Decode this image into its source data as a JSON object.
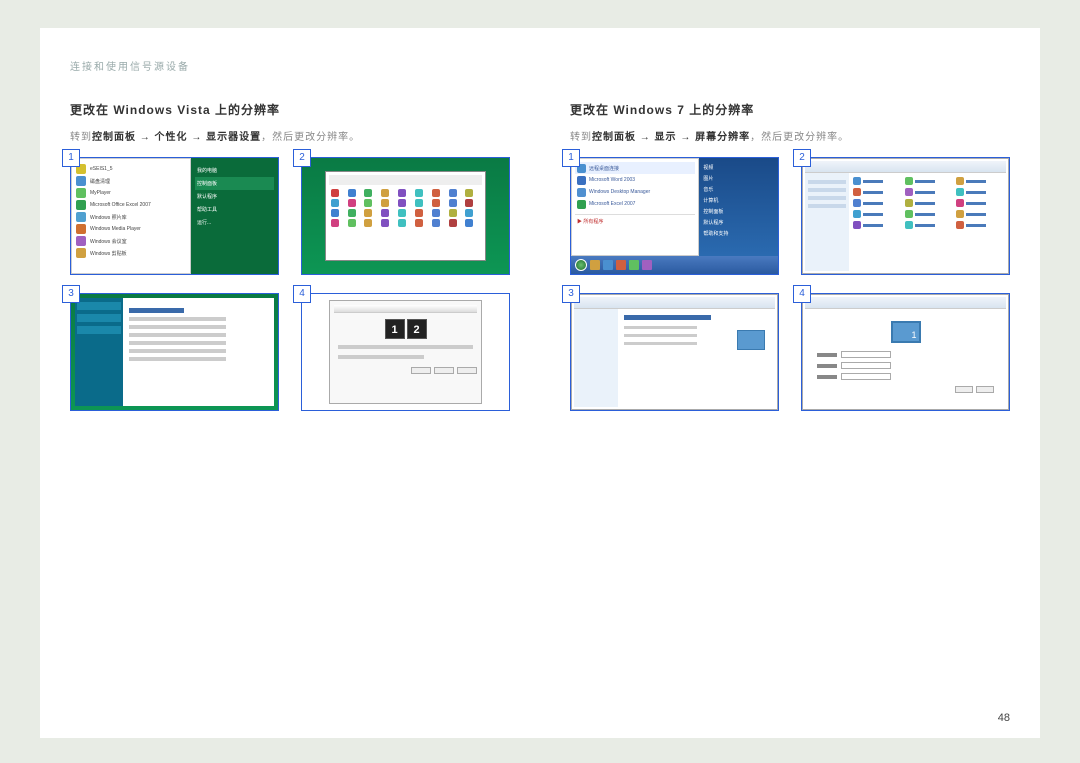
{
  "header": "连接和使用信号源设备",
  "page_number": "48",
  "vista": {
    "title": "更改在 Windows Vista 上的分辨率",
    "path_prefix": "转到",
    "path_bold": "控制面板 → 个性化 → 显示器设置",
    "path_suffix": "，然后更改分辨率。",
    "steps": [
      "1",
      "2",
      "3",
      "4"
    ],
    "step4_monitors": [
      "1",
      "2"
    ],
    "start_menu_left": [
      "eSEIS1_5",
      "磁盘清理",
      "MyPlayer",
      "Microsoft Office Excel 2007",
      "Windows 照片库",
      "Windows Media Player",
      "Windows 会议室",
      "Windows 剪贴板"
    ],
    "start_menu_right": [
      "我的电脑",
      "控制面板",
      "默认程序",
      "帮助工具",
      "运行..."
    ]
  },
  "win7": {
    "title": "更改在 Windows 7 上的分辨率",
    "path_prefix": "转到",
    "path_bold": "控制面板 → 显示 → 屏幕分辨率",
    "path_suffix": "，然后更改分辨率。",
    "steps": [
      "1",
      "2",
      "3",
      "4"
    ],
    "start_menu_left": [
      "远程桌面连接",
      "",
      "Microsoft Word 2003",
      "Windows Desktop Manager",
      "Microsoft Excel 2007"
    ],
    "start_hl": "▶ 所有程序",
    "start_menu_right": [
      "视频",
      "图片",
      "音乐",
      "计算机",
      "控制面板",
      "默认程序",
      "帮助和支持"
    ]
  }
}
